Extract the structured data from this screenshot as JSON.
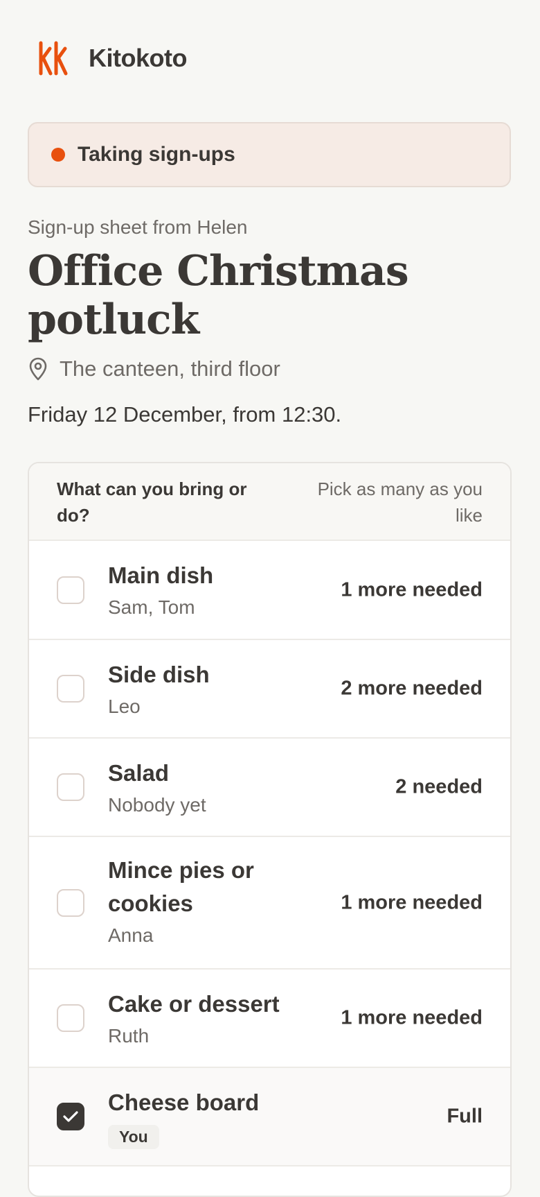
{
  "app": {
    "name": "Kitokoto",
    "logo": "kk-logo",
    "accent_color": "#e8500e"
  },
  "status": {
    "label": "Taking sign-ups",
    "icon": "status-dot"
  },
  "event": {
    "from": "Sign-up sheet from Helen",
    "title": "Office Christmas potluck",
    "location": "The canteen, third floor",
    "location_icon": "map-pin-icon",
    "when": "Friday 12 December, from 12:30."
  },
  "signup": {
    "question": "What can you bring or do?",
    "hint": "Pick as many as you like",
    "items": [
      {
        "name": "Main dish",
        "people": "Sam, Tom",
        "need": "1 more needed",
        "checked": false
      },
      {
        "name": "Side dish",
        "people": "Leo",
        "need": "2 more needed",
        "checked": false
      },
      {
        "name": "Salad",
        "people": "Nobody yet",
        "need": "2 needed",
        "checked": false
      },
      {
        "name": "Mince pies or cookies",
        "people": "Anna",
        "need": "1 more needed",
        "checked": false
      },
      {
        "name": "Cake or dessert",
        "people": "Ruth",
        "need": "1 more needed",
        "checked": false
      },
      {
        "name": "Cheese board",
        "people": "You",
        "need": "Full",
        "checked": true
      }
    ]
  }
}
